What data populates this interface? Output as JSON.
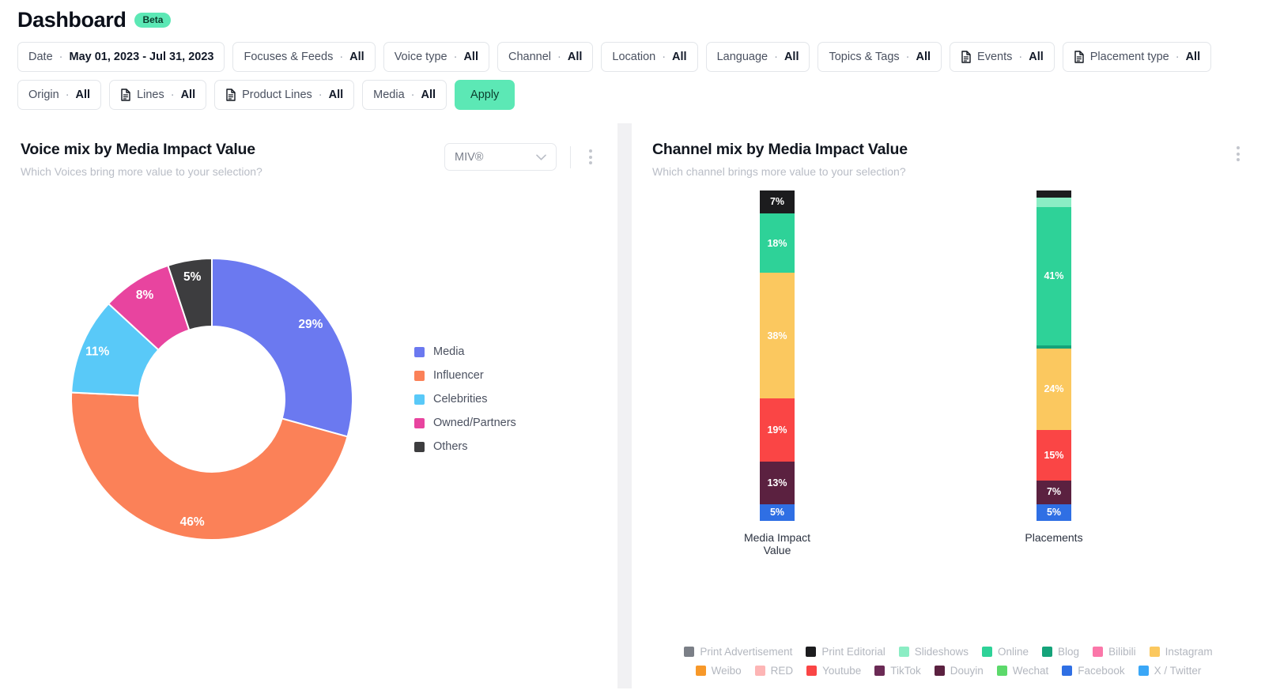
{
  "header": {
    "title": "Dashboard",
    "badge": "Beta"
  },
  "filters": {
    "apply_label": "Apply",
    "chips": [
      {
        "label": "Date",
        "value": "May 01, 2023 - Jul 31, 2023",
        "icon": null
      },
      {
        "label": "Focuses & Feeds",
        "value": "All",
        "icon": null
      },
      {
        "label": "Voice type",
        "value": "All",
        "icon": null
      },
      {
        "label": "Channel",
        "value": "All",
        "icon": null
      },
      {
        "label": "Location",
        "value": "All",
        "icon": null
      },
      {
        "label": "Language",
        "value": "All",
        "icon": null
      },
      {
        "label": "Topics & Tags",
        "value": "All",
        "icon": null
      },
      {
        "label": "Events",
        "value": "All",
        "icon": "document-icon"
      },
      {
        "label": "Placement type",
        "value": "All",
        "icon": "document-icon"
      },
      {
        "label": "Origin",
        "value": "All",
        "icon": null
      },
      {
        "label": "Lines",
        "value": "All",
        "icon": "document-icon"
      },
      {
        "label": "Product Lines",
        "value": "All",
        "icon": "document-icon"
      },
      {
        "label": "Media",
        "value": "All",
        "icon": null
      }
    ],
    "separator": "·"
  },
  "voice_panel": {
    "title": "Voice mix by Media Impact Value",
    "subtitle": "Which Voices bring more value to your selection?",
    "metric_selected": "MIV®",
    "menu_icon": "kebab-menu-icon"
  },
  "channel_panel": {
    "title": "Channel mix by Media Impact Value",
    "subtitle": "Which channel brings more value to your selection?",
    "menu_icon": "kebab-menu-icon"
  },
  "chart_data": [
    {
      "type": "pie",
      "title": "Voice mix by Media Impact Value",
      "subtitle": "Which Voices bring more value to your selection?",
      "donut": true,
      "legend_position": "right",
      "categories": [
        "Media",
        "Influencer",
        "Celebrities",
        "Owned/Partners",
        "Others"
      ],
      "values": [
        29,
        46,
        11,
        8,
        5
      ],
      "labels": [
        "29%",
        "46%",
        "11%",
        "8%",
        "5%"
      ],
      "colors": [
        "#6b79f0",
        "#fb8158",
        "#59c9f8",
        "#e8449f",
        "#3d3d3f"
      ],
      "unit": "%"
    },
    {
      "type": "bar",
      "stacked": true,
      "title": "Channel mix by Media Impact Value",
      "subtitle": "Which channel brings more value to your selection?",
      "xlabel": "",
      "ylabel": "",
      "ylim": [
        0,
        100
      ],
      "grid": false,
      "legend_position": "bottom",
      "categories": [
        "Media Impact Value",
        "Placements"
      ],
      "series": [
        {
          "name": "Print Advertisement",
          "color": "#7b7f87",
          "values": [
            0,
            0
          ]
        },
        {
          "name": "Print Editorial",
          "color": "#1c1c1e",
          "values": [
            7,
            2
          ]
        },
        {
          "name": "Slideshows",
          "color": "#8bedc4",
          "values": [
            0,
            3
          ]
        },
        {
          "name": "Online",
          "color": "#2ed298",
          "values": [
            18,
            41
          ]
        },
        {
          "name": "Blog",
          "color": "#15a37a",
          "values": [
            0,
            1
          ]
        },
        {
          "name": "Bilibili",
          "color": "#fb77a9",
          "values": [
            0,
            0
          ]
        },
        {
          "name": "Instagram",
          "color": "#fbc85f",
          "values": [
            38,
            24
          ]
        },
        {
          "name": "Weibo",
          "color": "#f79829",
          "values": [
            0,
            0
          ]
        },
        {
          "name": "RED",
          "color": "#fdb5b5",
          "values": [
            0,
            0
          ]
        },
        {
          "name": "Youtube",
          "color": "#fa4545",
          "values": [
            19,
            15
          ]
        },
        {
          "name": "TikTok",
          "color": "#6b2a55",
          "values": [
            0,
            0
          ]
        },
        {
          "name": "Douyin",
          "color": "#5b2140",
          "values": [
            13,
            7
          ]
        },
        {
          "name": "Wechat",
          "color": "#5cd96b",
          "values": [
            0,
            0
          ]
        },
        {
          "name": "Facebook",
          "color": "#2f6fe4",
          "values": [
            5,
            5
          ]
        },
        {
          "name": "X / Twitter",
          "color": "#3aa7f7",
          "values": [
            0,
            0
          ]
        }
      ],
      "bars": [
        {
          "axis_label": "Media Impact Value",
          "segments": [
            {
              "name": "Print Editorial",
              "value": 7,
              "label": "7%",
              "color": "#1c1c1e"
            },
            {
              "name": "Online",
              "value": 18,
              "label": "18%",
              "color": "#2ed298"
            },
            {
              "name": "Instagram",
              "value": 38,
              "label": "38%",
              "color": "#fbc85f"
            },
            {
              "name": "Youtube",
              "value": 19,
              "label": "19%",
              "color": "#fa4545"
            },
            {
              "name": "Douyin",
              "value": 13,
              "label": "13%",
              "color": "#5b2140"
            },
            {
              "name": "Facebook",
              "value": 5,
              "label": "5%",
              "color": "#2f6fe4"
            }
          ]
        },
        {
          "axis_label": "Placements",
          "segments": [
            {
              "name": "Print Editorial",
              "value": 2,
              "label": "",
              "color": "#1c1c1e"
            },
            {
              "name": "Slideshows",
              "value": 3,
              "label": "",
              "color": "#8bedc4"
            },
            {
              "name": "Online",
              "value": 41,
              "label": "41%",
              "color": "#2ed298"
            },
            {
              "name": "Blog",
              "value": 1,
              "label": "",
              "color": "#15a37a"
            },
            {
              "name": "Instagram",
              "value": 24,
              "label": "24%",
              "color": "#fbc85f"
            },
            {
              "name": "Youtube",
              "value": 15,
              "label": "15%",
              "color": "#fa4545"
            },
            {
              "name": "Douyin",
              "value": 7,
              "label": "7%",
              "color": "#5b2140"
            },
            {
              "name": "Facebook",
              "value": 5,
              "label": "5%",
              "color": "#2f6fe4"
            }
          ]
        }
      ],
      "legend_rows": [
        [
          "Print Advertisement",
          "Print Editorial",
          "Slideshows",
          "Online",
          "Blog",
          "Bilibili",
          "Instagram"
        ],
        [
          "Weibo",
          "RED",
          "Youtube",
          "TikTok",
          "Douyin",
          "Wechat",
          "Facebook",
          "X / Twitter"
        ]
      ]
    }
  ]
}
